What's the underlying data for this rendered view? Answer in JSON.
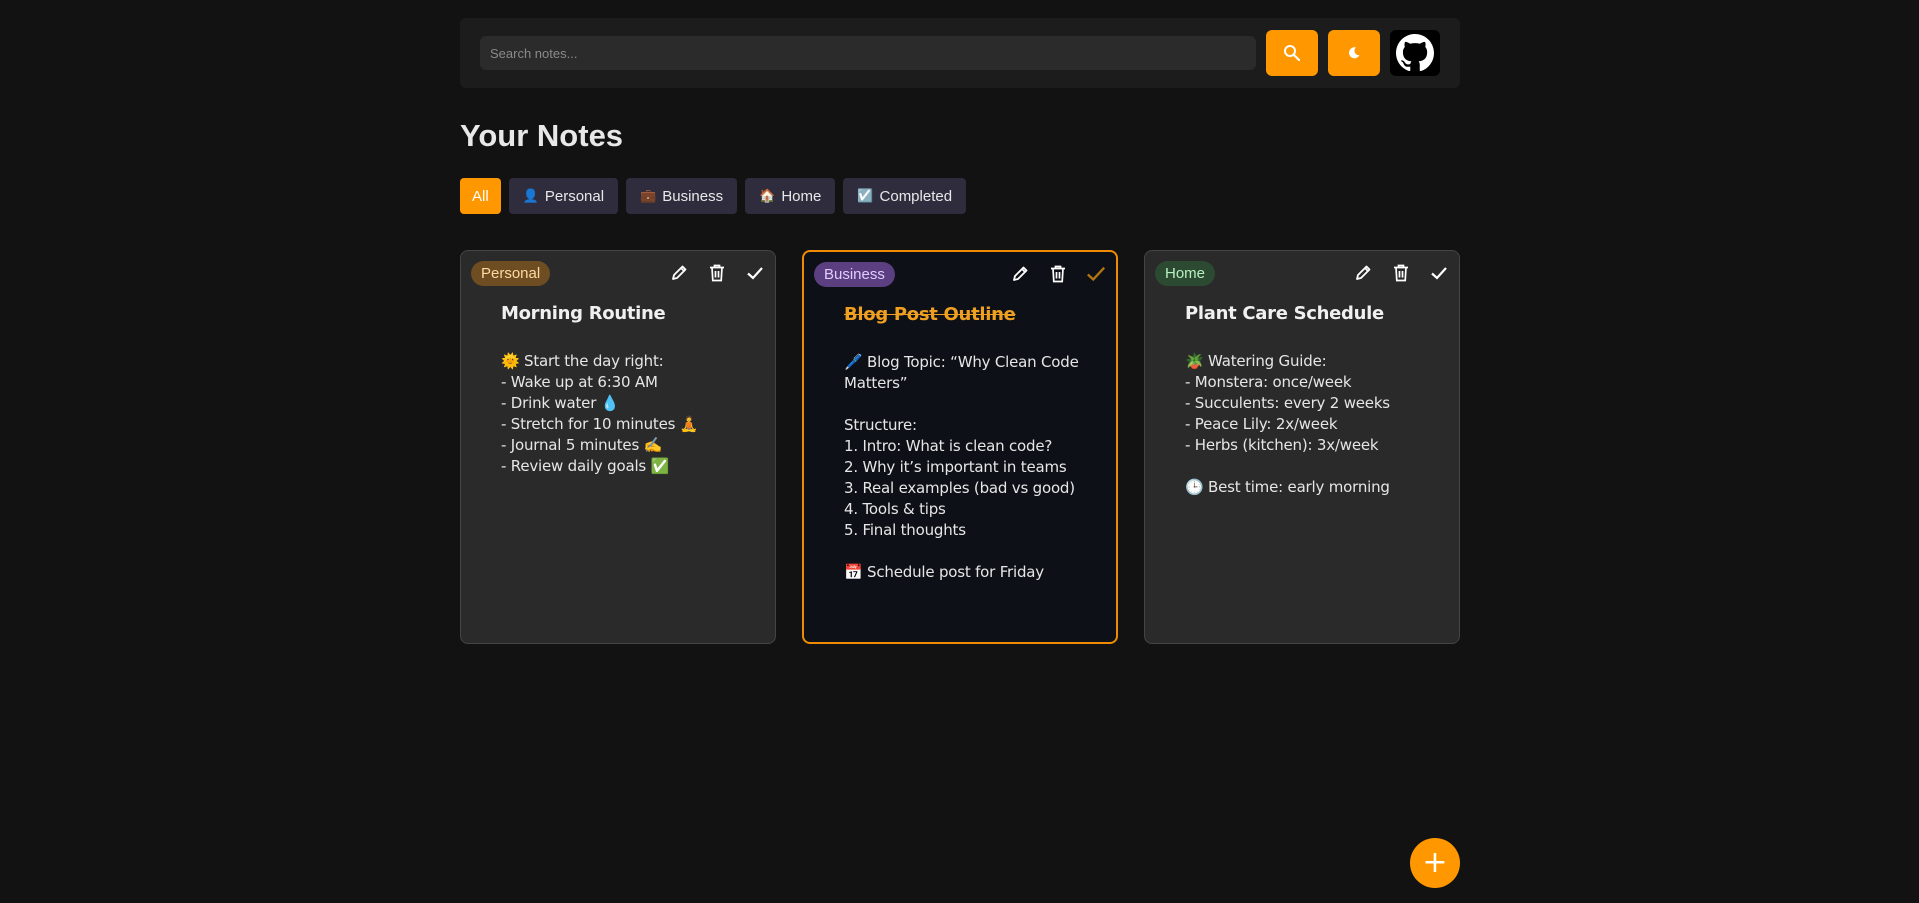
{
  "header": {
    "search_placeholder": "Search notes...",
    "search_icon": "search-icon",
    "theme_icon": "moon-icon",
    "github_icon": "github-icon",
    "accent": "#ff9800"
  },
  "page_title": "Your Notes",
  "filters": [
    {
      "label": "All",
      "emoji": "",
      "active": true
    },
    {
      "label": "Personal",
      "emoji": "👤",
      "active": false
    },
    {
      "label": "Business",
      "emoji": "💼",
      "active": false
    },
    {
      "label": "Home",
      "emoji": "🏠",
      "active": false
    },
    {
      "label": "Completed",
      "emoji": "☑️",
      "active": false
    }
  ],
  "notes": [
    {
      "tag": "Personal",
      "title": "Morning Routine",
      "completed": false,
      "body": "🌞 Start the day right:\n- Wake up at 6:30 AM\n- Drink water 💧\n- Stretch for 10 minutes 🧘\n- Journal 5 minutes ✍️\n- Review daily goals ✅"
    },
    {
      "tag": "Business",
      "title": "Blog Post Outline",
      "completed": true,
      "body": "🖊️ Blog Topic: “Why Clean Code Matters”\n\nStructure:\n1. Intro: What is clean code?\n2. Why it’s important in teams\n3. Real examples (bad vs good)\n4. Tools & tips\n5. Final thoughts\n\n📅 Schedule post for Friday"
    },
    {
      "tag": "Home",
      "title": "Plant Care Schedule",
      "completed": false,
      "body": "🪴 Watering Guide:\n- Monstera: once/week\n- Succulents: every 2 weeks\n- Peace Lily: 2x/week\n- Herbs (kitchen): 3x/week\n\n🕒 Best time: early morning"
    }
  ],
  "fab_label": "+"
}
